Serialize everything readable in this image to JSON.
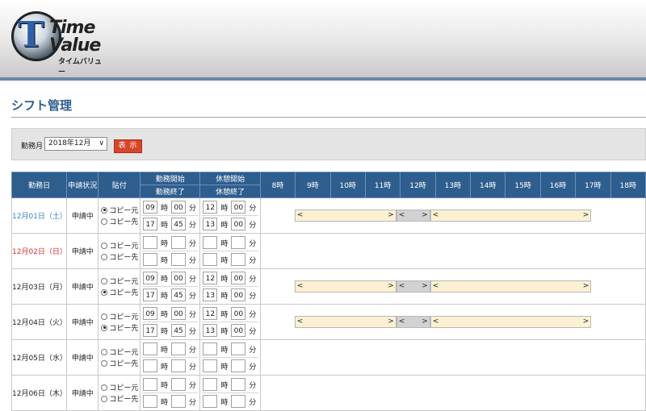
{
  "logo": {
    "time": "Time",
    "value": "Value",
    "kana": "タイムバリュー"
  },
  "page_title": "シフト管理",
  "filter": {
    "label": "勤務月",
    "month": "2018年12月",
    "show_label": "表 示"
  },
  "columns": {
    "date": "勤務日",
    "status": "申請状況",
    "paste": "貼付",
    "work_start": "勤務開始",
    "work_end": "勤務終了",
    "break_start": "休憩開始",
    "break_end": "休憩終了",
    "hours": [
      "8時",
      "9時",
      "10時",
      "11時",
      "12時",
      "13時",
      "14時",
      "15時",
      "16時",
      "17時",
      "18時"
    ]
  },
  "copy_labels": {
    "src": "コピー元",
    "dst": "コピー先"
  },
  "units": {
    "hour": "時",
    "minute": "分"
  },
  "arrows": {
    "left": "<",
    "right": ">"
  },
  "colors": {
    "header_blue": "#2e5e8e",
    "work_segment": "#fbf1d2",
    "break_segment": "#d2d2d2",
    "show_button": "#d9452b",
    "saturday": "#3b7fc4",
    "sunday": "#d62e2e"
  },
  "rows": [
    {
      "date": "12月01日（土）",
      "day_type": "blue",
      "status": "申請中",
      "copy": "src",
      "work_start": [
        "09",
        "00"
      ],
      "work_end": [
        "17",
        "45"
      ],
      "break_start": [
        "12",
        "00"
      ],
      "break_end": [
        "13",
        "00"
      ]
    },
    {
      "date": "12月02日（日）",
      "day_type": "red",
      "status": "申請中",
      "copy": "",
      "work_start": [
        "",
        ""
      ],
      "work_end": [
        "",
        ""
      ],
      "break_start": [
        "",
        ""
      ],
      "break_end": [
        "",
        ""
      ]
    },
    {
      "date": "12月03日（月）",
      "day_type": "normal",
      "status": "申請中",
      "copy": "dst",
      "work_start": [
        "09",
        "00"
      ],
      "work_end": [
        "17",
        "45"
      ],
      "break_start": [
        "12",
        "00"
      ],
      "break_end": [
        "13",
        "00"
      ]
    },
    {
      "date": "12月04日（火）",
      "day_type": "normal",
      "status": "申請中",
      "copy": "dst",
      "work_start": [
        "09",
        "00"
      ],
      "work_end": [
        "17",
        "45"
      ],
      "break_start": [
        "12",
        "00"
      ],
      "break_end": [
        "13",
        "00"
      ]
    },
    {
      "date": "12月05日（水）",
      "day_type": "normal",
      "status": "申請中",
      "copy": "",
      "work_start": [
        "",
        ""
      ],
      "work_end": [
        "",
        ""
      ],
      "break_start": [
        "",
        ""
      ],
      "break_end": [
        "",
        ""
      ]
    },
    {
      "date": "12月06日（木）",
      "day_type": "normal",
      "status": "申請中",
      "copy": "",
      "work_start": [
        "",
        ""
      ],
      "work_end": [
        "",
        ""
      ],
      "break_start": [
        "",
        ""
      ],
      "break_end": [
        "",
        ""
      ]
    }
  ]
}
